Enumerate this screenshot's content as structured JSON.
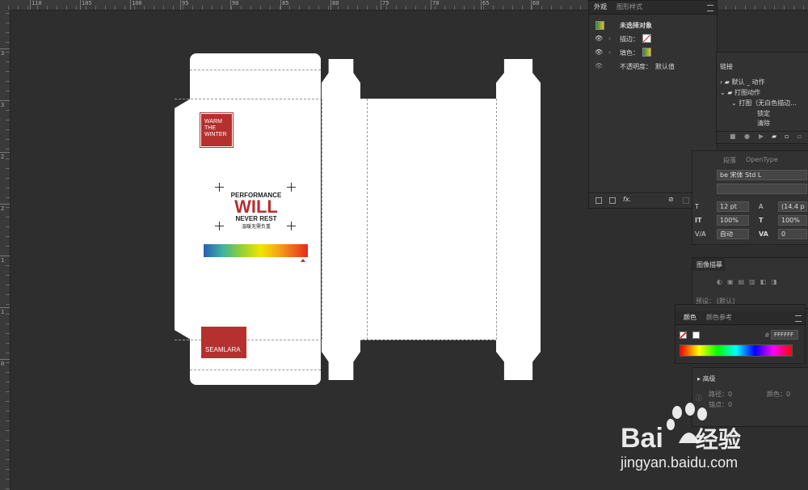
{
  "ruler": {
    "top_labels": [
      "110",
      "105",
      "100",
      "95",
      "90",
      "85",
      "80",
      "75",
      "70",
      "65",
      "60"
    ],
    "left_labels": [
      "3",
      "3",
      "2",
      "2",
      "1",
      "1",
      "0"
    ]
  },
  "artwork": {
    "badge_top": "WARM\nTHE\nWINTER",
    "line1": "PERFORMANCE",
    "line2": "WILL",
    "line3": "NEVER REST",
    "line4": "温暖无需负重",
    "brand": "SEAMLARA",
    "colors": {
      "brand_red": "#b5302e",
      "dark_text": "#222222"
    }
  },
  "appearance_panel": {
    "tabs": [
      "外观",
      "图形样式"
    ],
    "title": "未选择对象",
    "stroke_label": "描边：",
    "fill_label": "填色：",
    "opacity_label": "不透明度：",
    "opacity_value": "默认值",
    "footer_icons": [
      "new-layer-icon",
      "duplicate-icon",
      "fx-icon",
      "clear-icon",
      "copy-icon",
      "trash-icon"
    ]
  },
  "actions_panel": {
    "tab": "链接",
    "items": [
      "默认 _ 动作",
      "打图动作",
      "打图（无白色描边...",
      "锁定",
      "清除"
    ]
  },
  "character_panel": {
    "tabs": [
      "段落",
      "OpenType"
    ],
    "font_family": "be 宋体 Std L",
    "font_size": "12 pt",
    "leading": "(14.4 p",
    "vscale": "100%",
    "hscale": "100%",
    "kerning": "自动",
    "tracking": "0",
    "row_values": [
      "0"
    ]
  },
  "image_trace_panel": {
    "title": "图像描摹",
    "preset_label": "预设：",
    "preset_value": "[默认]"
  },
  "color_panel": {
    "tabs": [
      "颜色",
      "颜色参考"
    ],
    "hex_label": "#",
    "hex_value": "FFFFFF",
    "advanced_label": "高级",
    "info_paths": "路径：0",
    "info_anchors": "锚点：0",
    "info_colors": "颜色：0"
  },
  "watermark": {
    "brand": "Bai",
    "brand_cn": "经验",
    "url": "jingyan.baidu.com"
  }
}
